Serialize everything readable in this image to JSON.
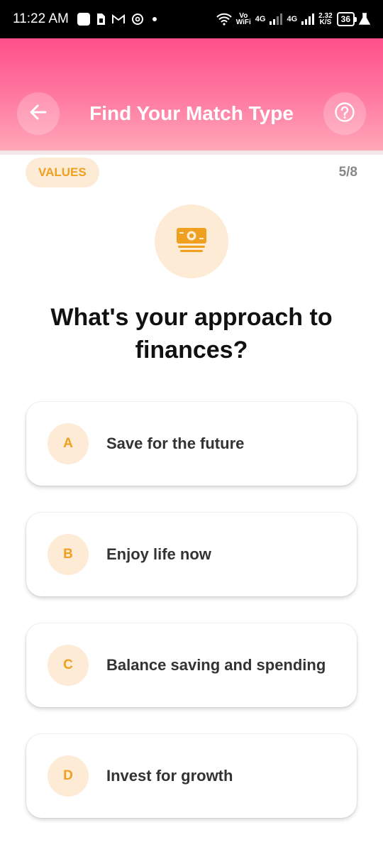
{
  "status_bar": {
    "time": "11:22 AM",
    "left_icons": [
      "square-icon",
      "sim-icon",
      "gmail-icon",
      "threads-icon",
      "dot-icon"
    ],
    "vowifi_top": "Vo",
    "vowifi_bottom": "WiFi",
    "net1": "4G",
    "net2": "4G",
    "speed_top": "2.32",
    "speed_bottom": "K/S",
    "battery": "36"
  },
  "header": {
    "title": "Find Your Match Type",
    "back_icon": "arrow-left-icon",
    "help_icon": "question-circle-icon"
  },
  "category": {
    "label": "VALUES"
  },
  "progress": {
    "text": "5/8"
  },
  "question": {
    "icon": "money-icon",
    "text": "What's your approach to finances?"
  },
  "options": [
    {
      "letter": "A",
      "text": "Save for the future"
    },
    {
      "letter": "B",
      "text": "Enjoy life now"
    },
    {
      "letter": "C",
      "text": "Balance saving and spending"
    },
    {
      "letter": "D",
      "text": "Invest for growth"
    }
  ],
  "colors": {
    "header_top": "#ff4f8a",
    "header_bottom": "#ffa8b8",
    "accent": "#f0a020",
    "accent_bg": "#fdebd6"
  }
}
